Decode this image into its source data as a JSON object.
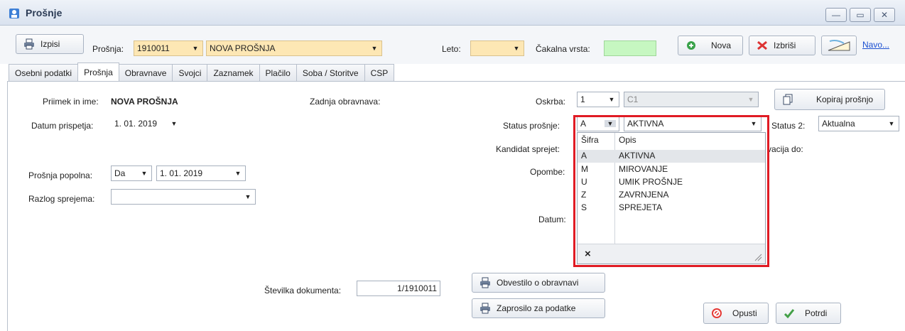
{
  "window": {
    "title": "Prošnje"
  },
  "toolbar": {
    "print_label": "Izpisi",
    "prosnja_label": "Prošnja:",
    "prosnja_number": "1910011",
    "prosnja_name": "NOVA PROŠNJA",
    "leto_label": "Leto:",
    "leto_value": "",
    "cakalna_label": "Čakalna vrsta:",
    "cakalna_value": "",
    "new_label": "Nova",
    "delete_label": "Izbriši",
    "navodila_link": "Navo..."
  },
  "tabs": [
    "Osebni podatki",
    "Prošnja",
    "Obravnave",
    "Svojci",
    "Zaznamek",
    "Plačilo",
    "Soba / Storitve",
    "CSP"
  ],
  "form": {
    "priimek_label": "Priimek in ime:",
    "priimek_value": "NOVA PROŠNJA",
    "zadnja_label": "Zadnja obravnava:",
    "datum_prispetja_label": "Datum prispetja:",
    "datum_prispetja_value": "1. 01. 2019",
    "oskrba_label": "Oskrba:",
    "oskrba_value": "1",
    "oskrba_desc": "C1",
    "kopiraj_label": "Kopiraj prošnjo",
    "status_label": "Status prošnje:",
    "status_code": "A",
    "status_desc": "AKTIVNA",
    "status2_label": "Status 2:",
    "status2_value": "Aktualna",
    "kandidat_label": "Kandidat sprejet:",
    "rezervacija_label": "vacija do:",
    "popolna_label": "Prošnja popolna:",
    "popolna_value": "Da",
    "popolna_date": "1. 01. 2019",
    "opombe_label": "Opombe:",
    "razlog_label": "Razlog sprejema:",
    "razlog_value": "",
    "datum_label": "Datum:",
    "stevilka_label": "Številka dokumenta:",
    "stevilka_value": "1/1910011"
  },
  "dropdown": {
    "header_code": "Šifra",
    "header_desc": "Opis",
    "items": [
      {
        "code": "A",
        "desc": "AKTIVNA"
      },
      {
        "code": "M",
        "desc": "MIROVANJE"
      },
      {
        "code": "U",
        "desc": "UMIK PROŠNJE"
      },
      {
        "code": "Z",
        "desc": "ZAVRNJENA"
      },
      {
        "code": "S",
        "desc": "SPREJETA"
      }
    ],
    "clear_symbol": "×"
  },
  "actions": {
    "obvestilo_label": "Obvestilo o obravnavi",
    "zaprosilo_label": "Zaprosilo za podatke",
    "opusti_label": "Opusti",
    "potrdi_label": "Potrdi"
  },
  "colors": {
    "highlight": "#e01b24",
    "yellow_field": "#fde7b4",
    "green_field": "#c6f7c1"
  }
}
